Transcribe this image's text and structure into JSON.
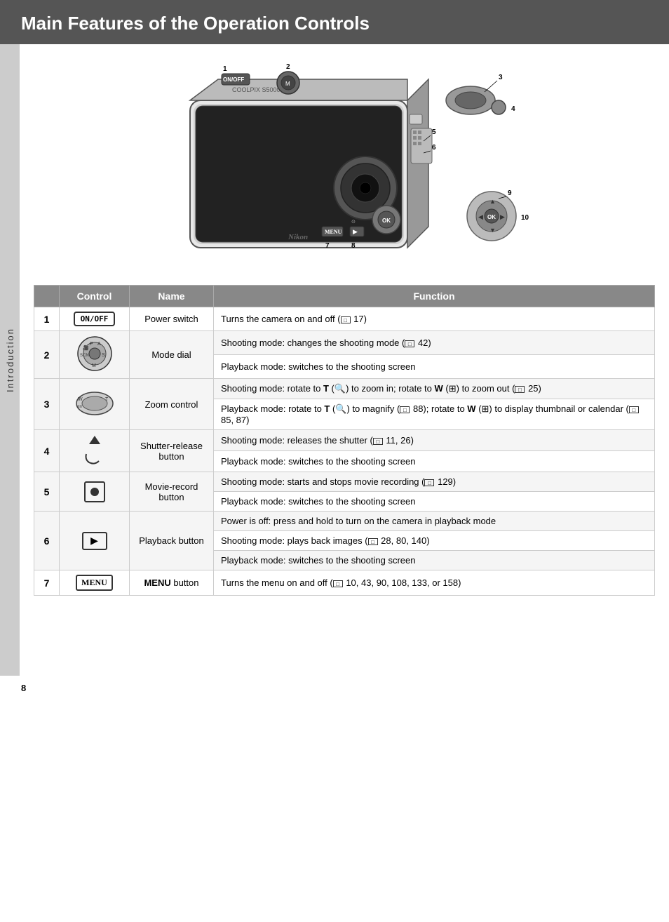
{
  "page": {
    "title": "Main Features of the Operation Controls",
    "sidebar_label": "Introduction",
    "page_number": "8"
  },
  "table": {
    "headers": [
      "Control",
      "Name",
      "Function"
    ],
    "rows": [
      {
        "num": "1",
        "control_type": "onoff",
        "name": "Power switch",
        "functions": [
          "Turns the camera on and off (□□ 17)"
        ],
        "rowspan": 1
      },
      {
        "num": "2",
        "control_type": "dial",
        "name": "Mode dial",
        "functions": [
          "Shooting mode: changes the shooting mode (□□ 42)",
          "Playback mode: switches to the shooting screen"
        ],
        "rowspan": 2
      },
      {
        "num": "3",
        "control_type": "zoom",
        "name": "Zoom control",
        "functions": [
          "Shooting mode: rotate to T (🔍) to zoom in; rotate to W (▣) to zoom out (□□ 25)",
          "Playback mode: rotate to T (🔍) to magnify (□□ 88); rotate to W (▣) to display thumbnail or calendar (□□ 85, 87)"
        ],
        "rowspan": 2
      },
      {
        "num": "4",
        "control_type": "shutter",
        "name": "Shutter-release button",
        "functions": [
          "Shooting mode: releases the shutter (□□ 11, 26)",
          "Playback mode: switches to the shooting screen"
        ],
        "rowspan": 2
      },
      {
        "num": "5",
        "control_type": "record",
        "name": "Movie-record button",
        "functions": [
          "Shooting mode: starts and stops movie recording (□□ 129)",
          "Playback mode: switches to the shooting screen"
        ],
        "rowspan": 2
      },
      {
        "num": "6",
        "control_type": "playback",
        "name": "Playback button",
        "functions": [
          "Power is off: press and hold to turn on the camera in playback mode",
          "Shooting mode: plays back images (□□ 28, 80, 140)",
          "Playback mode: switches to the shooting screen"
        ],
        "rowspan": 3
      },
      {
        "num": "7",
        "control_type": "menu",
        "name": "MENU button",
        "functions": [
          "Turns the menu on and off (□□ 10, 43, 90, 108, 133, or 158)"
        ],
        "rowspan": 1
      }
    ]
  }
}
